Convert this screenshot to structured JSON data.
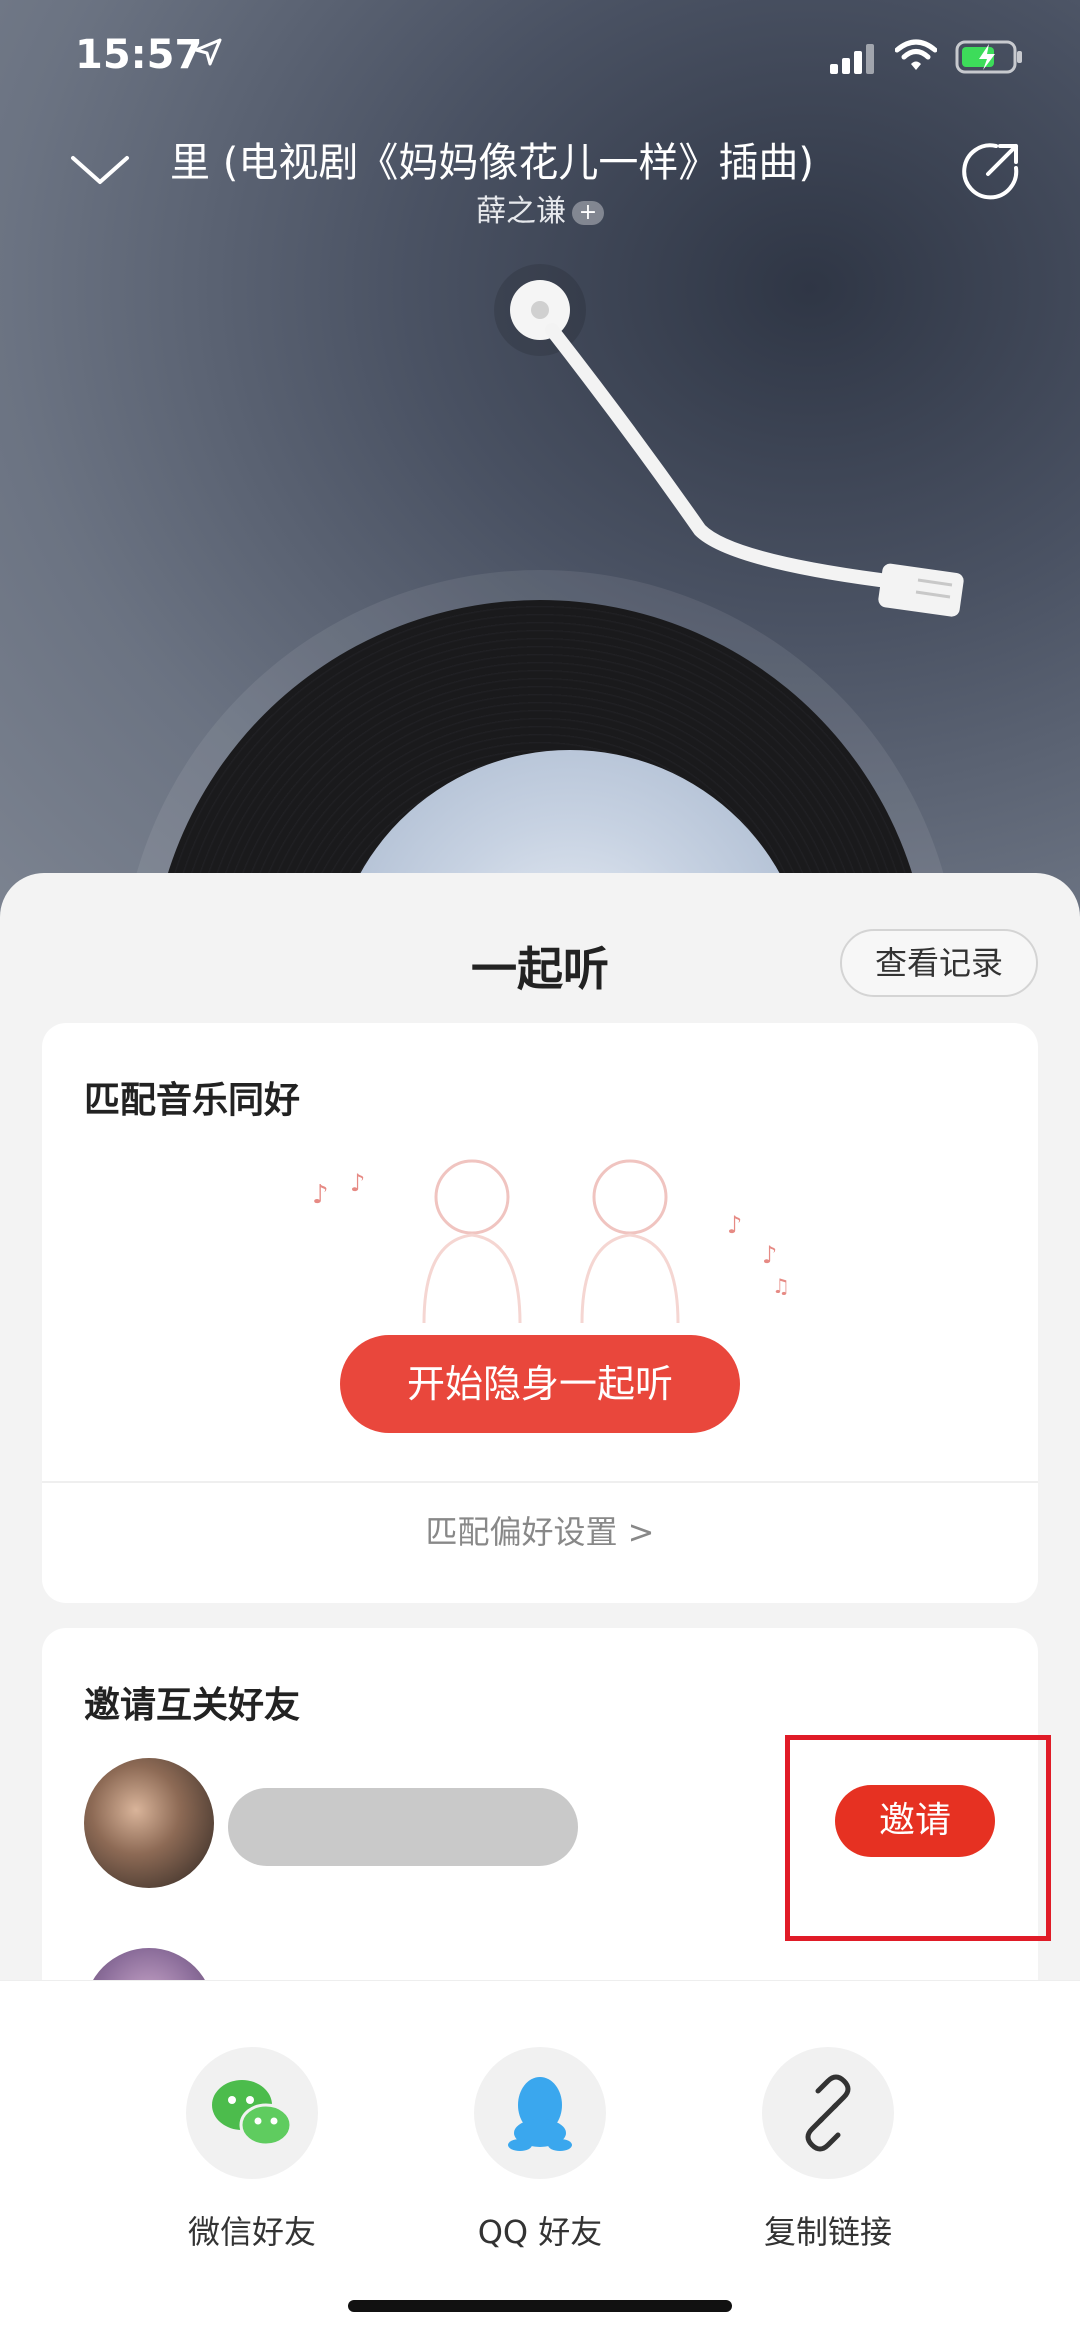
{
  "status_bar": {
    "time": "15:57"
  },
  "header": {
    "song_title": "里 (电视剧《妈妈像花儿一样》插曲)",
    "artist": "薛之谦",
    "artist_plus": "+"
  },
  "sheet": {
    "title": "一起听",
    "record_button": "查看记录"
  },
  "match_card": {
    "title": "匹配音乐同好",
    "start_button": "开始隐身一起听",
    "preference_link": "匹配偏好设置 >"
  },
  "invite_card": {
    "title": "邀请互关好友",
    "invite_button": "邀请"
  },
  "share_options": [
    {
      "label": "微信好友",
      "icon": "wechat-icon"
    },
    {
      "label": "QQ 好友",
      "icon": "qq-icon"
    },
    {
      "label": "复制链接",
      "icon": "link-icon"
    }
  ],
  "colors": {
    "accent": "#e9473c",
    "invite": "#e63122",
    "highlight": "#e01b27"
  }
}
